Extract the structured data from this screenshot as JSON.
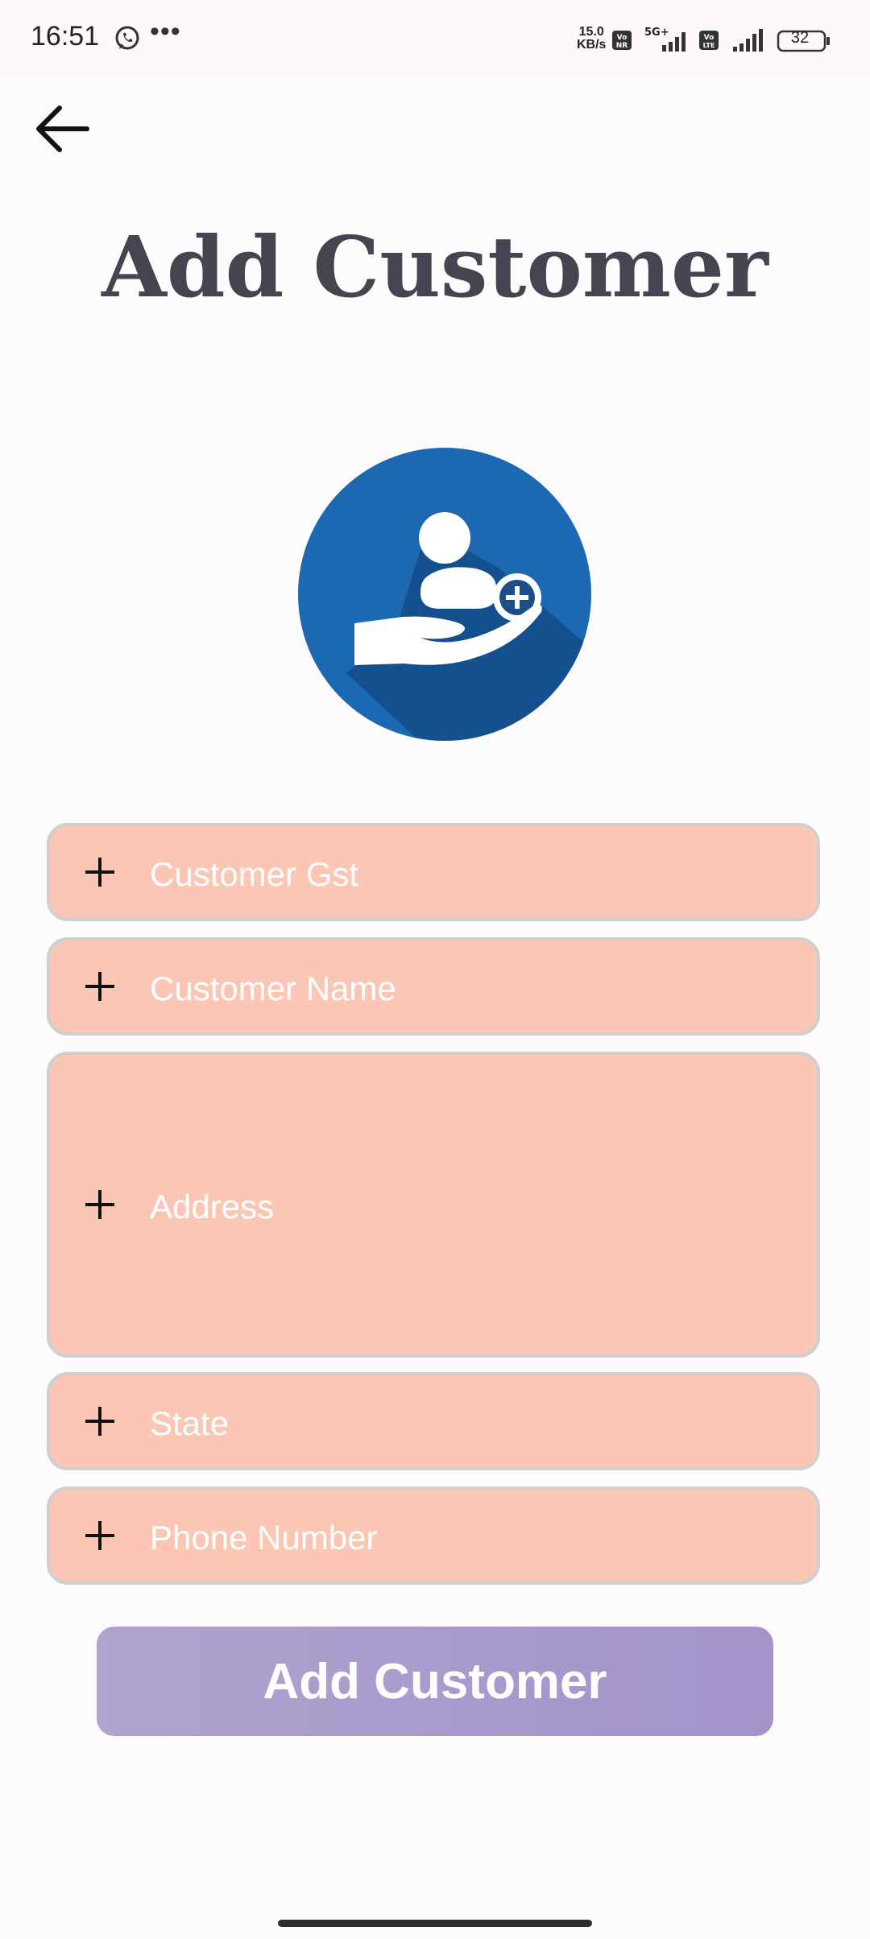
{
  "status_bar": {
    "time": "16:51",
    "more": "•••",
    "net_speed_value": "15.0",
    "net_speed_unit": "KB/s",
    "network_label": "5G+",
    "battery": "32"
  },
  "header": {
    "back_icon": "arrow-left-icon",
    "title": "Add Customer"
  },
  "hero": {
    "icon": "add-customer-hand-icon",
    "accent_color": "#1d68b3"
  },
  "form": {
    "fields": [
      {
        "icon": "plus-icon",
        "placeholder": "Customer Gst"
      },
      {
        "icon": "plus-icon",
        "placeholder": "Customer Name"
      },
      {
        "icon": "plus-icon",
        "placeholder": "Address"
      },
      {
        "icon": "plus-icon",
        "placeholder": "State"
      },
      {
        "icon": "plus-icon",
        "placeholder": "Phone Number"
      }
    ],
    "field_color": "#fcc6b4",
    "submit_label": "Add Customer",
    "submit_color": "#a89bcc"
  }
}
